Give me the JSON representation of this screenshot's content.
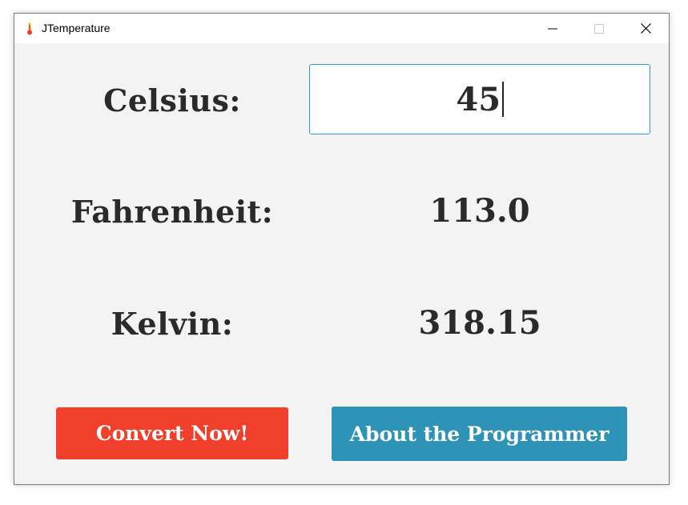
{
  "window": {
    "title": "JTemperature",
    "icon": "thermometer-icon"
  },
  "celsius": {
    "label": "Celsius:",
    "value": "45"
  },
  "fahrenheit": {
    "label": "Fahrenheit:",
    "value": "113.0"
  },
  "kelvin": {
    "label": "Kelvin:",
    "value": "318.15"
  },
  "buttons": {
    "convert_label": "Convert Now!",
    "about_label": "About the Programmer"
  },
  "colors": {
    "convert_button": "#f0402c",
    "about_button": "#2e93b6",
    "input_focus_border": "#2a9fd6",
    "background": "#f3f3f3",
    "text": "#2a2a2a"
  }
}
